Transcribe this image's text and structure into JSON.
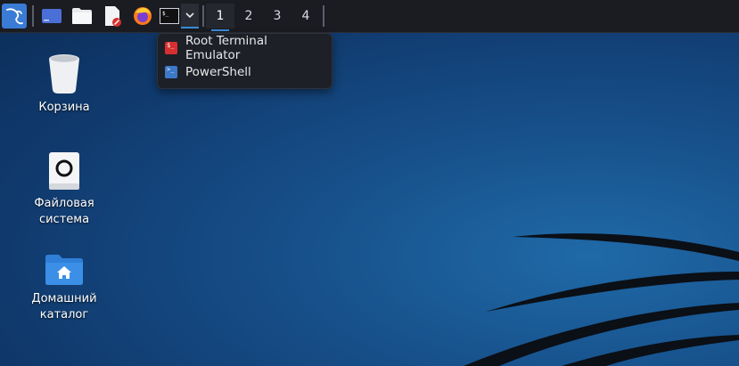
{
  "taskbar": {
    "launchers": [
      {
        "name": "kali-menu-icon"
      },
      {
        "name": "desktop-icon"
      },
      {
        "name": "file-manager-icon"
      },
      {
        "name": "text-editor-icon"
      },
      {
        "name": "firefox-icon"
      },
      {
        "name": "terminal-icon"
      }
    ],
    "workspaces": [
      "1",
      "2",
      "3",
      "4"
    ],
    "active_workspace": "1"
  },
  "terminal_menu": {
    "items": [
      {
        "label": "Root Terminal Emulator",
        "icon": "root-terminal-icon",
        "color": "#d62f2f"
      },
      {
        "label": "PowerShell",
        "icon": "powershell-icon",
        "color": "#3c79c8"
      }
    ]
  },
  "desktop": {
    "icons": [
      {
        "label": "Корзина",
        "icon": "trash-icon"
      },
      {
        "label_line1": "Файловая",
        "label_line2": "система",
        "icon": "drive-icon"
      },
      {
        "label_line1": "Домашний",
        "label_line2": "каталог",
        "icon": "home-folder-icon"
      }
    ]
  },
  "colors": {
    "taskbar_bg": "#1a1c22",
    "accent": "#3b8dd9",
    "desktop_bg": "#17508a"
  }
}
